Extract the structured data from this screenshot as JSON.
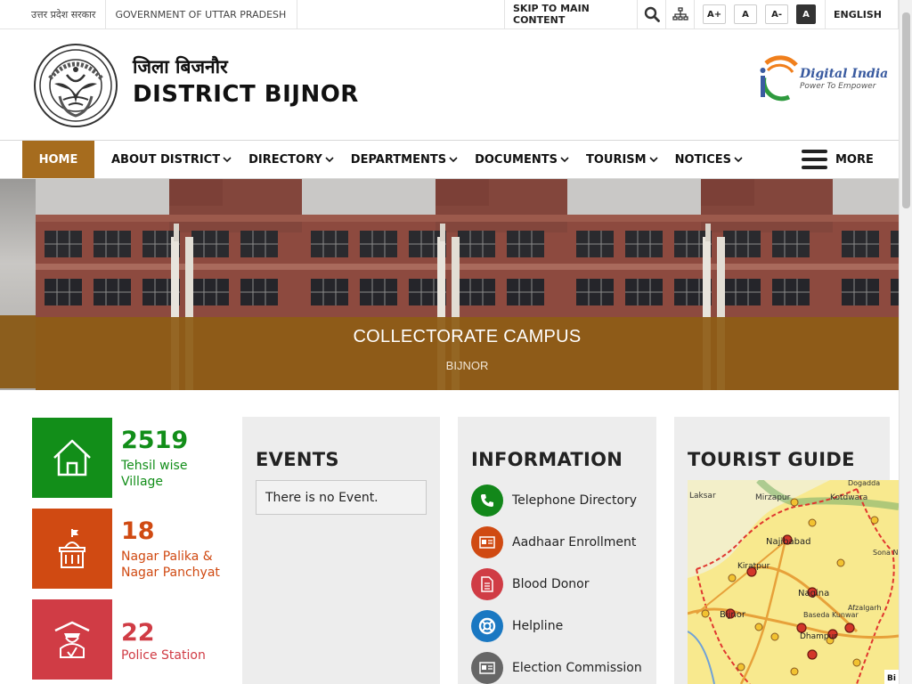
{
  "topbar": {
    "gov_hindi": "उत्तर प्रदेश सरकार",
    "gov_english": "GOVERNMENT OF UTTAR PRADESH",
    "skip": "SKIP TO MAIN CONTENT",
    "font_increase": "A+",
    "font_normal": "A",
    "font_decrease": "A-",
    "contrast": "A",
    "language": "ENGLISH"
  },
  "header": {
    "title_hindi": "जिला बिजनौर",
    "title_english": "DISTRICT BIJNOR",
    "digital_india": "Digital India",
    "digital_india_tagline": "Power To Empower"
  },
  "nav": {
    "home": "HOME",
    "items": [
      {
        "label": "ABOUT DISTRICT"
      },
      {
        "label": "DIRECTORY"
      },
      {
        "label": "DEPARTMENTS"
      },
      {
        "label": "DOCUMENTS"
      },
      {
        "label": "TOURISM"
      },
      {
        "label": "NOTICES"
      }
    ],
    "more": "MORE"
  },
  "banner": {
    "title": "COLLECTORATE CAMPUS",
    "subtitle": "BIJNOR"
  },
  "stats": [
    {
      "value": "2519",
      "label": "Tehsil wise Village",
      "color": "#128e19"
    },
    {
      "value": "18",
      "label": "Nagar Palika & Nagar Panchyat",
      "color": "#d04a12"
    },
    {
      "value": "22",
      "label": "Police Station",
      "color": "#d03c45"
    }
  ],
  "events": {
    "title": "EVENTS",
    "empty": "There is no Event."
  },
  "information": {
    "title": "INFORMATION",
    "items": [
      {
        "label": "Telephone Directory",
        "icon": "phone-icon",
        "color": "#12871a"
      },
      {
        "label": "Aadhaar Enrollment",
        "icon": "id-card-icon",
        "color": "#d04a12"
      },
      {
        "label": "Blood Donor",
        "icon": "document-icon",
        "color": "#d03c45"
      },
      {
        "label": "Helpline",
        "icon": "lifebuoy-icon",
        "color": "#1a78c2"
      },
      {
        "label": "Election Commission",
        "icon": "id-card-icon",
        "color": "#666666"
      }
    ]
  },
  "tourist": {
    "title": "TOURIST GUIDE",
    "map_labels": [
      "Laksar",
      "Mirzapur",
      "Kotdwara",
      "Dogadda",
      "Najibabad",
      "Kiratpur",
      "Nagina",
      "Bijnor",
      "Baseda Kunwar",
      "Afzalgarh",
      "Dhampur",
      "Sona Nadi",
      "Bi"
    ]
  },
  "colors": {
    "accent": "#a66c1e",
    "overlay": "#8e5d16"
  }
}
